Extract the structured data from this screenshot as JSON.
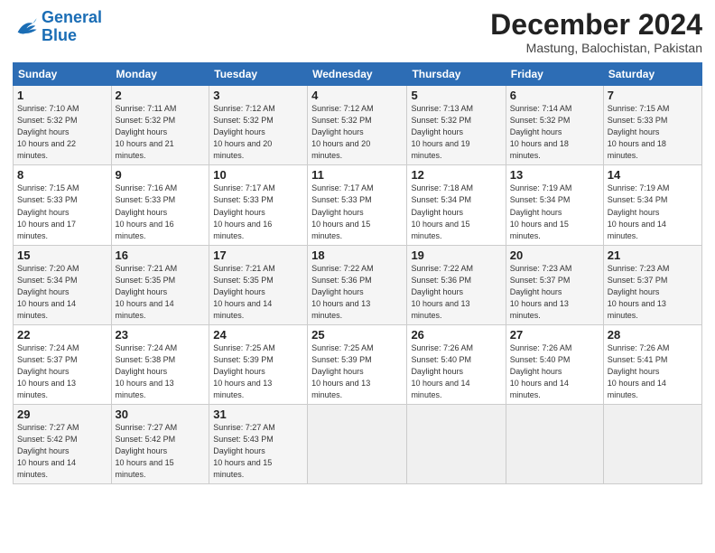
{
  "header": {
    "logo_line1": "General",
    "logo_line2": "Blue",
    "month": "December 2024",
    "location": "Mastung, Balochistan, Pakistan"
  },
  "days_of_week": [
    "Sunday",
    "Monday",
    "Tuesday",
    "Wednesday",
    "Thursday",
    "Friday",
    "Saturday"
  ],
  "weeks": [
    [
      {
        "day": "1",
        "sunrise": "7:10 AM",
        "sunset": "5:32 PM",
        "daylight": "10 hours and 22 minutes."
      },
      {
        "day": "2",
        "sunrise": "7:11 AM",
        "sunset": "5:32 PM",
        "daylight": "10 hours and 21 minutes."
      },
      {
        "day": "3",
        "sunrise": "7:12 AM",
        "sunset": "5:32 PM",
        "daylight": "10 hours and 20 minutes."
      },
      {
        "day": "4",
        "sunrise": "7:12 AM",
        "sunset": "5:32 PM",
        "daylight": "10 hours and 20 minutes."
      },
      {
        "day": "5",
        "sunrise": "7:13 AM",
        "sunset": "5:32 PM",
        "daylight": "10 hours and 19 minutes."
      },
      {
        "day": "6",
        "sunrise": "7:14 AM",
        "sunset": "5:32 PM",
        "daylight": "10 hours and 18 minutes."
      },
      {
        "day": "7",
        "sunrise": "7:15 AM",
        "sunset": "5:33 PM",
        "daylight": "10 hours and 18 minutes."
      }
    ],
    [
      {
        "day": "8",
        "sunrise": "7:15 AM",
        "sunset": "5:33 PM",
        "daylight": "10 hours and 17 minutes."
      },
      {
        "day": "9",
        "sunrise": "7:16 AM",
        "sunset": "5:33 PM",
        "daylight": "10 hours and 16 minutes."
      },
      {
        "day": "10",
        "sunrise": "7:17 AM",
        "sunset": "5:33 PM",
        "daylight": "10 hours and 16 minutes."
      },
      {
        "day": "11",
        "sunrise": "7:17 AM",
        "sunset": "5:33 PM",
        "daylight": "10 hours and 15 minutes."
      },
      {
        "day": "12",
        "sunrise": "7:18 AM",
        "sunset": "5:34 PM",
        "daylight": "10 hours and 15 minutes."
      },
      {
        "day": "13",
        "sunrise": "7:19 AM",
        "sunset": "5:34 PM",
        "daylight": "10 hours and 15 minutes."
      },
      {
        "day": "14",
        "sunrise": "7:19 AM",
        "sunset": "5:34 PM",
        "daylight": "10 hours and 14 minutes."
      }
    ],
    [
      {
        "day": "15",
        "sunrise": "7:20 AM",
        "sunset": "5:34 PM",
        "daylight": "10 hours and 14 minutes."
      },
      {
        "day": "16",
        "sunrise": "7:21 AM",
        "sunset": "5:35 PM",
        "daylight": "10 hours and 14 minutes."
      },
      {
        "day": "17",
        "sunrise": "7:21 AM",
        "sunset": "5:35 PM",
        "daylight": "10 hours and 14 minutes."
      },
      {
        "day": "18",
        "sunrise": "7:22 AM",
        "sunset": "5:36 PM",
        "daylight": "10 hours and 13 minutes."
      },
      {
        "day": "19",
        "sunrise": "7:22 AM",
        "sunset": "5:36 PM",
        "daylight": "10 hours and 13 minutes."
      },
      {
        "day": "20",
        "sunrise": "7:23 AM",
        "sunset": "5:37 PM",
        "daylight": "10 hours and 13 minutes."
      },
      {
        "day": "21",
        "sunrise": "7:23 AM",
        "sunset": "5:37 PM",
        "daylight": "10 hours and 13 minutes."
      }
    ],
    [
      {
        "day": "22",
        "sunrise": "7:24 AM",
        "sunset": "5:37 PM",
        "daylight": "10 hours and 13 minutes."
      },
      {
        "day": "23",
        "sunrise": "7:24 AM",
        "sunset": "5:38 PM",
        "daylight": "10 hours and 13 minutes."
      },
      {
        "day": "24",
        "sunrise": "7:25 AM",
        "sunset": "5:39 PM",
        "daylight": "10 hours and 13 minutes."
      },
      {
        "day": "25",
        "sunrise": "7:25 AM",
        "sunset": "5:39 PM",
        "daylight": "10 hours and 13 minutes."
      },
      {
        "day": "26",
        "sunrise": "7:26 AM",
        "sunset": "5:40 PM",
        "daylight": "10 hours and 14 minutes."
      },
      {
        "day": "27",
        "sunrise": "7:26 AM",
        "sunset": "5:40 PM",
        "daylight": "10 hours and 14 minutes."
      },
      {
        "day": "28",
        "sunrise": "7:26 AM",
        "sunset": "5:41 PM",
        "daylight": "10 hours and 14 minutes."
      }
    ],
    [
      {
        "day": "29",
        "sunrise": "7:27 AM",
        "sunset": "5:42 PM",
        "daylight": "10 hours and 14 minutes."
      },
      {
        "day": "30",
        "sunrise": "7:27 AM",
        "sunset": "5:42 PM",
        "daylight": "10 hours and 15 minutes."
      },
      {
        "day": "31",
        "sunrise": "7:27 AM",
        "sunset": "5:43 PM",
        "daylight": "10 hours and 15 minutes."
      },
      null,
      null,
      null,
      null
    ]
  ]
}
